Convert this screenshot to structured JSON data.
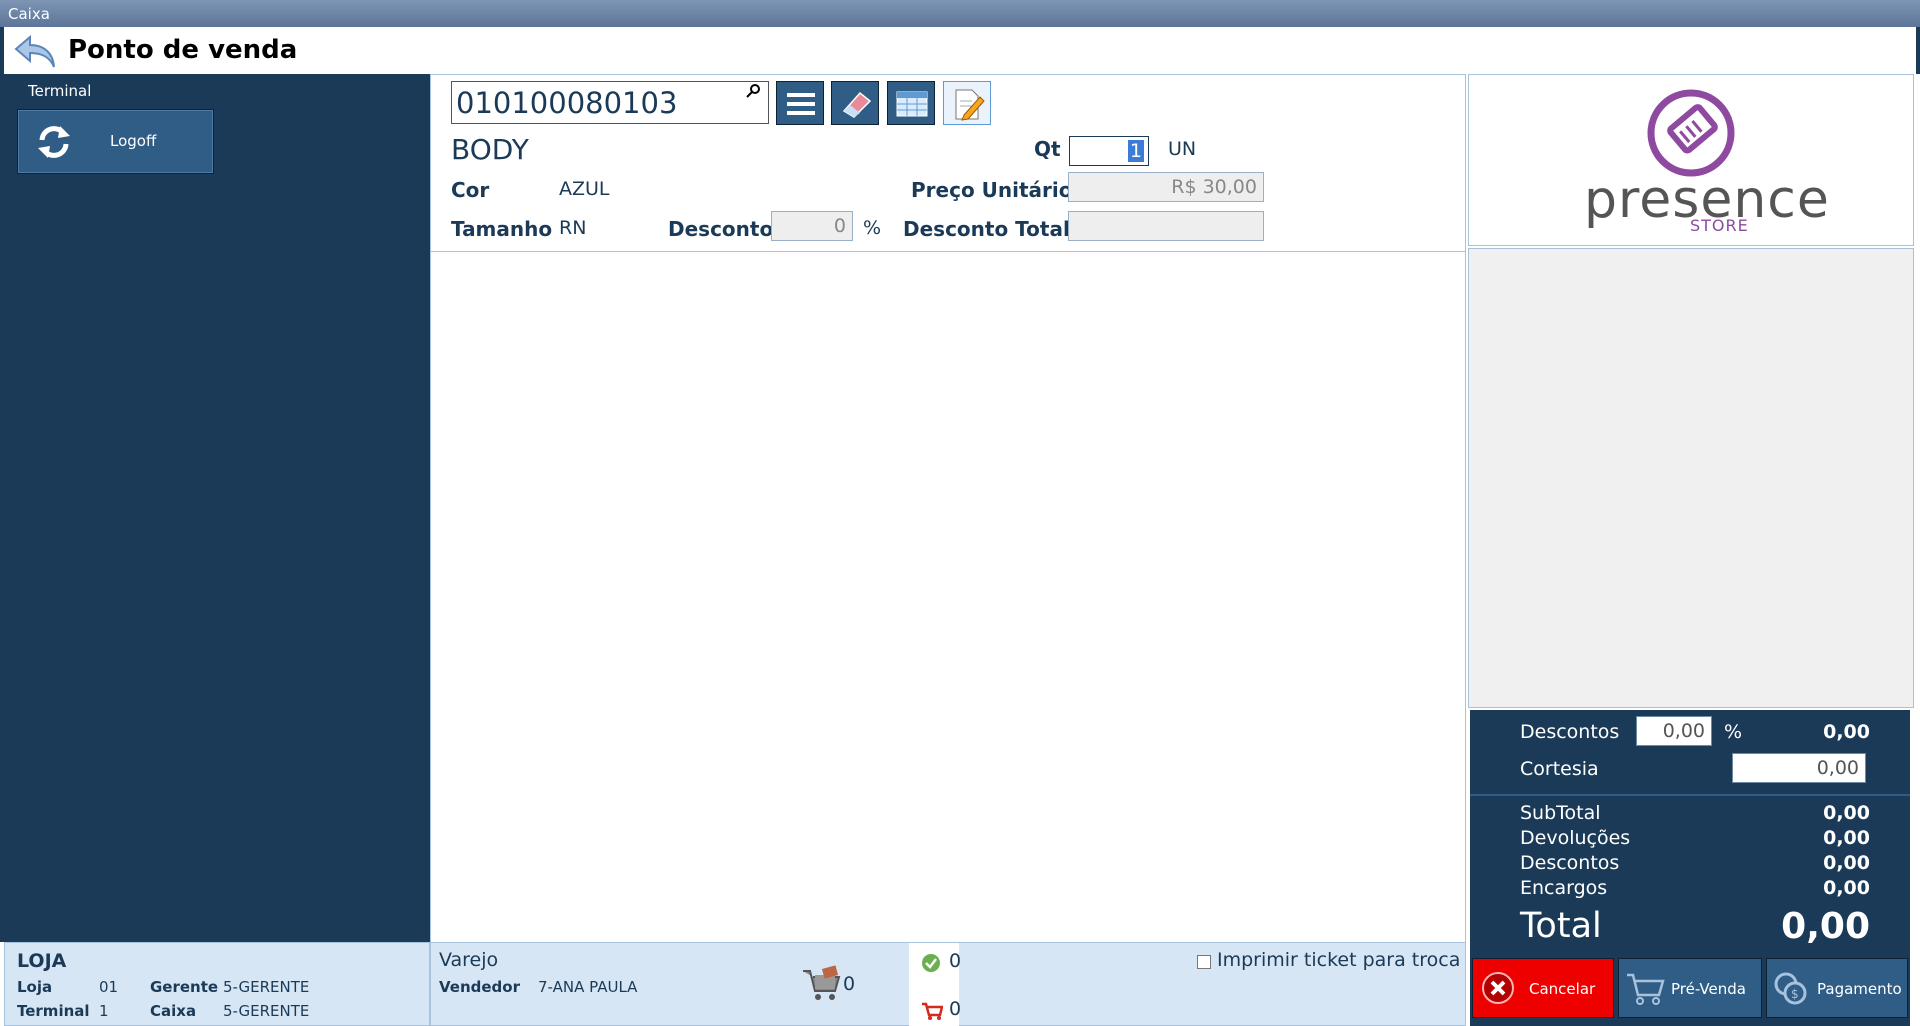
{
  "window": {
    "title": "Caixa"
  },
  "header": {
    "title": "Ponto de venda"
  },
  "sidebar": {
    "section_label": "Terminal",
    "logoff_label": "Logoff"
  },
  "store": {
    "title": "LOJA",
    "loja_label": "Loja",
    "loja_value": "01",
    "gerente_label": "Gerente",
    "gerente_value": "5-GERENTE",
    "terminal_label": "Terminal",
    "terminal_value": "1",
    "caixa_label": "Caixa",
    "caixa_value": "5-GERENTE"
  },
  "product": {
    "code": "010100080103",
    "name": "BODY",
    "qt_label": "Qt",
    "qt_value": "1",
    "unit": "UN",
    "cor_label": "Cor",
    "cor_value": "AZUL",
    "preco_label": "Preço Unitário",
    "preco_value": "R$ 30,00",
    "tamanho_label": "Tamanho",
    "tamanho_value": "RN",
    "desconto_label": "Desconto",
    "desconto_value": "0",
    "percent": "%",
    "desconto_total_label": "Desconto Total",
    "desconto_total_value": ""
  },
  "bottom": {
    "sale_type": "Varejo",
    "vendedor_label": "Vendedor",
    "vendedor_value": "7-ANA PAULA",
    "cart_count": "0",
    "ok_count": "0",
    "return_count": "0",
    "ticket_label": "Imprimir ticket para troca"
  },
  "logo": {
    "word": "presence",
    "sub": "STORE"
  },
  "totals": {
    "descontos_label": "Descontos",
    "descontos_input": "0,00",
    "percent": "%",
    "descontos_value": "0,00",
    "cortesia_label": "Cortesia",
    "cortesia_input": "0,00",
    "subtotal_label": "SubTotal",
    "subtotal_value": "0,00",
    "devolucoes_label": "Devoluções",
    "devolucoes_value": "0,00",
    "descontos2_label": "Descontos",
    "descontos2_value": "0,00",
    "encargos_label": "Encargos",
    "encargos_value": "0,00",
    "total_label": "Total",
    "total_value": "0,00"
  },
  "actions": {
    "cancel_label": "Cancelar",
    "prevenda_label": "Pré-Venda",
    "pagamento_label": "Pagamento"
  },
  "colors": {
    "sidebar": "#1b3a57",
    "button": "#2f5d86",
    "panel_light": "#d6e6f5",
    "cancel": "#ee0000",
    "brand": "#8d4aa0"
  }
}
